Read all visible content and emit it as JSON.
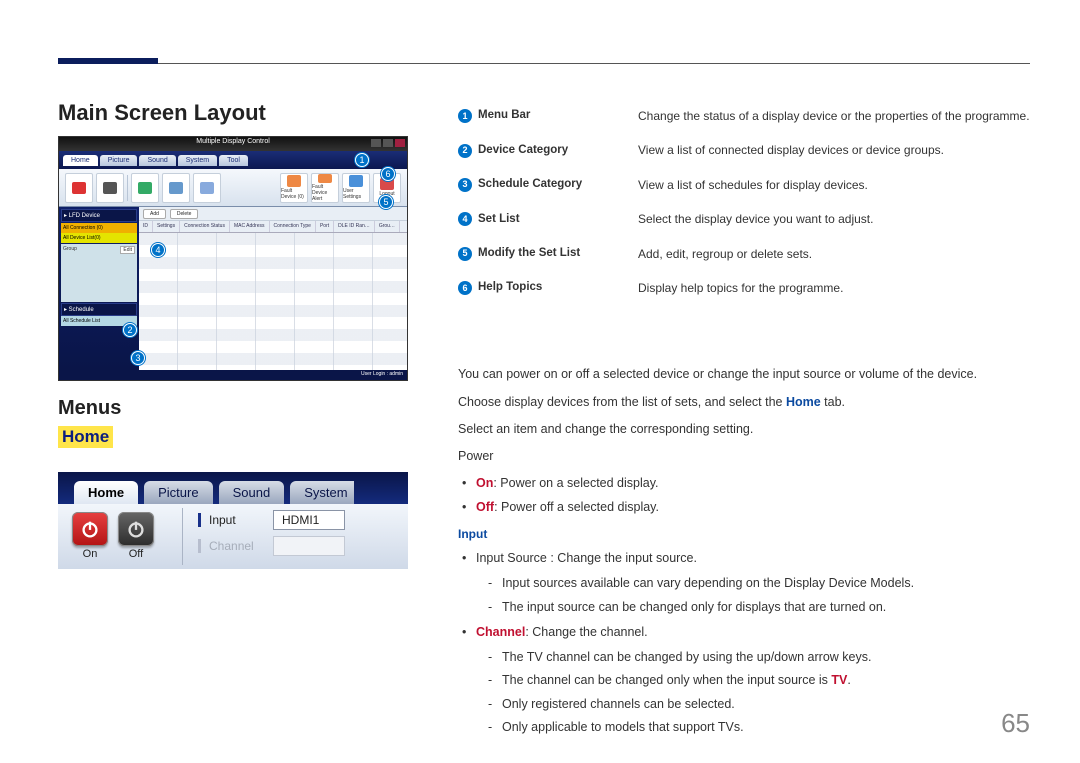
{
  "page_number": "65",
  "headings": {
    "main_screen_layout": "Main Screen Layout",
    "menus": "Menus",
    "home": "Home"
  },
  "reference": [
    {
      "num": "1",
      "label": "Menu Bar",
      "desc": "Change the status of a display device or the properties of the programme."
    },
    {
      "num": "2",
      "label": "Device Category",
      "desc": "View a list of connected display devices or device groups."
    },
    {
      "num": "3",
      "label": "Schedule Category",
      "desc": "View a list of schedules for display devices."
    },
    {
      "num": "4",
      "label": "Set List",
      "desc": "Select the display device you want to adjust."
    },
    {
      "num": "5",
      "label": "Modify the Set List",
      "desc": "Add, edit, regroup or delete sets."
    },
    {
      "num": "6",
      "label": "Help Topics",
      "desc": "Display help topics for the programme."
    }
  ],
  "shot1": {
    "title": "Multiple Display Control",
    "menutabs": [
      "Home",
      "Picture",
      "Sound",
      "System",
      "Tool"
    ],
    "toolbar_right": [
      "Fault Device (0)",
      "Fault Device Alert",
      "User Settings",
      "Logout"
    ],
    "side": {
      "cat1": "▸ LFD Device",
      "sel1": "All Connection (0)",
      "sel2": "All Device List(0)",
      "panel_label": "Group",
      "panel_btn": "Edit",
      "cat2": "▸ Schedule",
      "sel3": "All Schedule List"
    },
    "buttons": {
      "add": "Add",
      "delete": "Delete"
    },
    "headers": [
      "ID",
      "Settings",
      "Connection Status",
      "MAC Address",
      "Connection Type",
      "Port",
      "DLE ID Ran…",
      "Grou…"
    ],
    "footer": "User Login : admin"
  },
  "shot2": {
    "tabs": [
      "Home",
      "Picture",
      "Sound",
      "System"
    ],
    "on": "On",
    "off": "Off",
    "input_label": "Input",
    "input_value": "HDMI1",
    "channel_label": "Channel"
  },
  "body": {
    "p1": "You can power on or off a selected device or change the input source or volume of the device.",
    "p2_pre": "Choose display devices from the list of sets, and select the ",
    "p2_home": "Home",
    "p2_post": " tab.",
    "p3": "Select an item and change the corresponding setting.",
    "power": "Power",
    "on_label": "On",
    "on_desc": ": Power on a selected display.",
    "off_label": "Off",
    "off_desc": ": Power off a selected display.",
    "input_heading": "Input",
    "input_source": "Input Source : Change the input source.",
    "input_sub1": "Input sources available can vary depending on the Display Device Models.",
    "input_sub2": "The input source can be changed only for displays that are turned on.",
    "channel_label": "Channel",
    "channel_desc": ": Change the channel.",
    "channel_sub1_pre": "The TV channel can be changed by using the up/down arrow keys.",
    "channel_sub2_pre": "The channel can be changed only when the input source is ",
    "channel_sub2_tv": "TV",
    "channel_sub2_post": ".",
    "channel_sub3": "Only registered channels can be selected.",
    "channel_sub4": "Only applicable to models that support TVs."
  }
}
